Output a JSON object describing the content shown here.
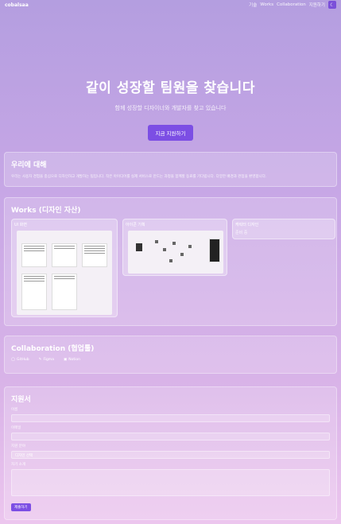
{
  "header": {
    "logo": "cobalsaa",
    "nav": [
      "기술",
      "Works",
      "Collaboration",
      "지원하기"
    ],
    "theme_icon": "moon-icon"
  },
  "hero": {
    "title": "같이 성장할 팀원을 찾습니다",
    "subtitle": "함께 성장할 디자이너와 개발자를 찾고 있습니다",
    "cta": "지금 지원하기"
  },
  "about": {
    "title": "우리에 대해",
    "text": "우리는 사용자 경험을 중심으로 디자인하고 개발하는 팀입니다. 작은 아이디어를 실제 서비스로 만드는 과정을 함께할 동료를 기다립니다. 다양한 배경과 관점을 환영합니다."
  },
  "works": {
    "title": "Works (디자인 자산)",
    "items": [
      {
        "label": "UI 화면"
      },
      {
        "label": "아이콘 기획"
      },
      {
        "label": "캐릭터 디자인",
        "sub": "준비 중"
      }
    ]
  },
  "collab": {
    "title": "Collaboration (협업툴)",
    "tools": [
      "GitHub",
      "Figma",
      "Notion"
    ]
  },
  "form": {
    "title": "지원서",
    "fields": [
      {
        "label": "이름",
        "placeholder": ""
      },
      {
        "label": "이메일",
        "placeholder": ""
      },
      {
        "label": "지원 분야",
        "placeholder": "디자인 선택"
      },
      {
        "label": "자기 소개",
        "placeholder": ""
      }
    ],
    "submit": "제출하기"
  },
  "colors": {
    "accent": "#7c4ee4",
    "bg_top": "#b49ee0",
    "bg_bottom": "#ecc6ee"
  }
}
